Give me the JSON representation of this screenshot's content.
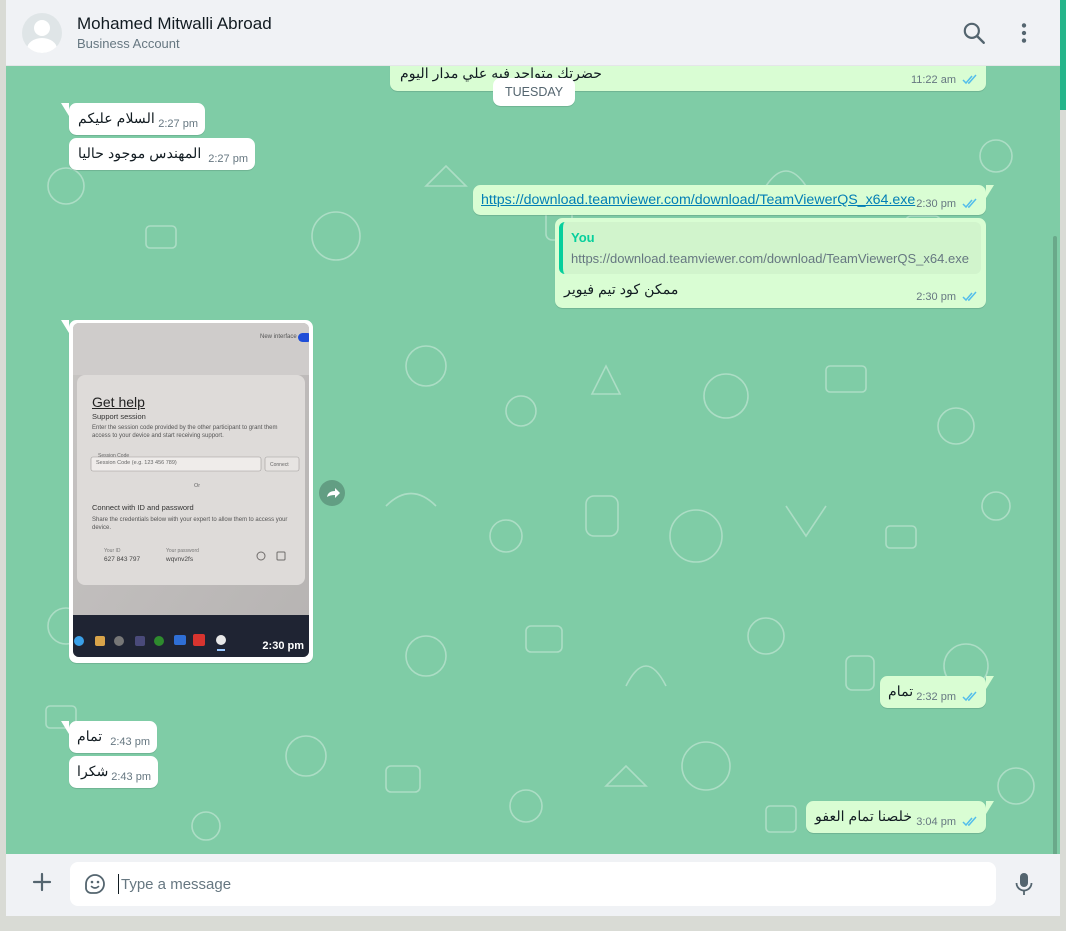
{
  "header": {
    "contact_name": "Mohamed Mitwalli Abroad",
    "contact_subtitle": "Business Account",
    "icons": [
      "search-icon",
      "menu-dots-icon"
    ]
  },
  "chat": {
    "date_separator": "TUESDAY",
    "messages": [
      {
        "id": "m0",
        "direction": "outgoing",
        "text": "حضرتك متواجد فيه علي مدار اليوم",
        "time": "11:22 am",
        "status": "read"
      },
      {
        "id": "m1",
        "direction": "incoming",
        "text": "السلام عليكم",
        "time": "2:27 pm"
      },
      {
        "id": "m2",
        "direction": "incoming",
        "text": "المهندس موجود حاليا",
        "time": "2:27 pm"
      },
      {
        "id": "m3",
        "direction": "outgoing",
        "text": "https://download.teamviewer.com/download/TeamViewerQS_x64.exe",
        "time": "2:30 pm",
        "status": "read"
      },
      {
        "id": "m4",
        "direction": "outgoing",
        "quote_author": "You",
        "quote_text": "https://download.teamviewer.com/download/TeamViewerQS_x64.exe",
        "text": "ممكن كود تيم فيوير",
        "time": "2:30 pm",
        "status": "read"
      },
      {
        "id": "m5",
        "direction": "incoming",
        "type": "image",
        "time": "2:30 pm"
      },
      {
        "id": "m6",
        "direction": "outgoing",
        "text": "تمام",
        "time": "2:32 pm",
        "status": "read"
      },
      {
        "id": "m7",
        "direction": "incoming",
        "text": "تمام",
        "time": "2:43 pm"
      },
      {
        "id": "m8",
        "direction": "incoming",
        "text": "شكرا",
        "time": "2:43 pm"
      },
      {
        "id": "m9",
        "direction": "outgoing",
        "text": "خلصنا تمام العفو",
        "time": "3:04 pm",
        "status": "read"
      }
    ]
  },
  "screenshot_content": {
    "toggle_label": "New interface",
    "title": "Get help",
    "subtitle": "Support session",
    "description": "Enter the session code provided by the other participant to grant them access to your device and start receiving support.",
    "session_label": "Session Code",
    "session_placeholder": "Session Code (e.g. 123 456 789)",
    "connect_label": "Connect",
    "or_label": "Or",
    "id_heading": "Connect with ID and password",
    "id_description": "Share the credentials below with your expert to allow them to access your device.",
    "your_id_label": "Your ID",
    "your_id_value": "627 843 797",
    "password_label": "Your password",
    "password_value": "wqvnv2fs"
  },
  "composer": {
    "placeholder": "Type a message",
    "icons": [
      "plus-icon",
      "emoji-icon",
      "mic-icon"
    ]
  },
  "colors": {
    "chat_bg": "#7fcca6",
    "incoming_bubble": "#ffffff",
    "outgoing_bubble": "#d9fdd3",
    "read_ticks": "#53bdeb",
    "accent": "#06cf9c",
    "link": "#027eb5"
  }
}
